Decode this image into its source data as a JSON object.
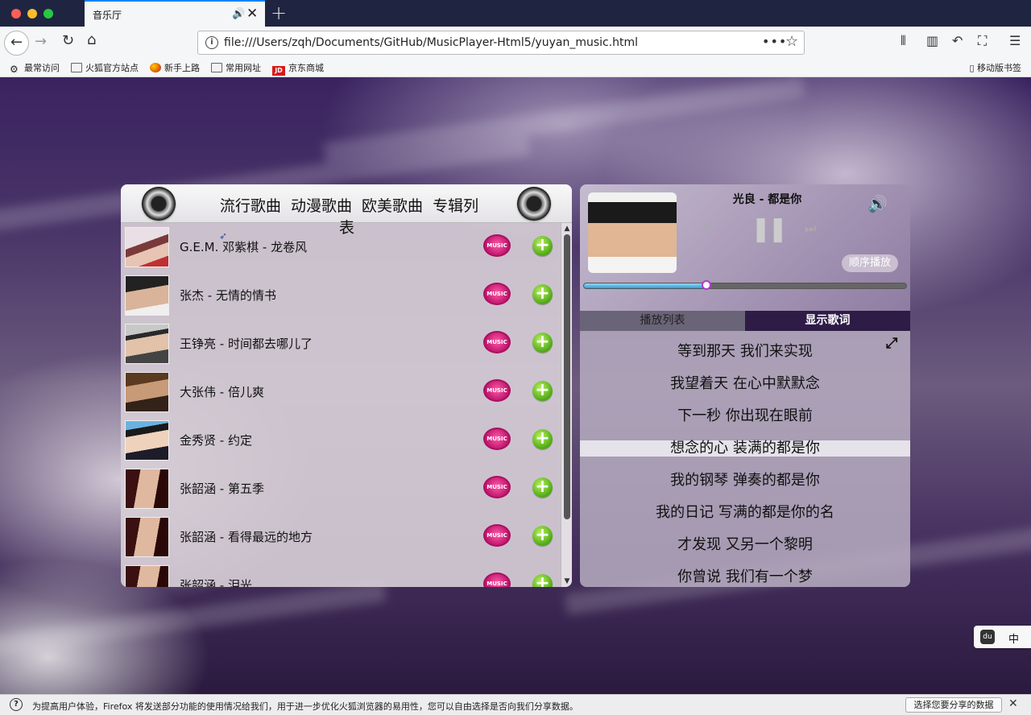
{
  "browser": {
    "tab_title": "音乐厅",
    "tab_audio_icon": "speaker-icon",
    "url": "file:///Users/zqh/Documents/GitHub/MusicPlayer-Html5/yuyan_music.html",
    "bookmarks": [
      "最常访问",
      "火狐官方站点",
      "新手上路",
      "常用网址",
      "京东商城"
    ],
    "bookmark_right": "移动版书签",
    "jd_label": "JD"
  },
  "playlist": {
    "categories": [
      "流行歌曲",
      "动漫歌曲",
      "欧美歌曲",
      "专辑列表"
    ],
    "songs": [
      {
        "title": "G.E.M. 邓紫棋 - 龙卷风",
        "music_label": "MUSIC"
      },
      {
        "title": "张杰 - 无情的情书",
        "music_label": "MUSIC"
      },
      {
        "title": "王铮亮 - 时间都去哪儿了",
        "music_label": "MUSIC"
      },
      {
        "title": "大张伟 - 倍儿爽",
        "music_label": "MUSIC"
      },
      {
        "title": "金秀贤 - 约定",
        "music_label": "MUSIC"
      },
      {
        "title": "张韶涵 - 第五季",
        "music_label": "MUSIC"
      },
      {
        "title": "张韶涵 - 看得最远的地方",
        "music_label": "MUSIC"
      },
      {
        "title": "张韶涵 - 泪光",
        "music_label": "MUSIC"
      }
    ]
  },
  "player": {
    "now_playing": "光良 - 都是你",
    "mode": "顺序播放",
    "progress": 0.38,
    "tabs": {
      "list": "播放列表",
      "lyrics": "显示歌词"
    },
    "lyrics": [
      "等到那天 我们来实现",
      "我望着天 在心中默默念",
      "下一秒 你出现在眼前",
      "想念的心 装满的都是你",
      "我的钢琴 弹奏的都是你",
      "我的日记 写满的都是你的名",
      "才发现 又另一个黎明",
      "你曾说 我们有一个梦"
    ],
    "current_lyric_index": 3
  },
  "widget": {
    "icon_label": "du",
    "text": "中"
  },
  "notice": {
    "text": "为提高用户体验，Firefox 将发送部分功能的使用情况给我们，用于进一步优化火狐浏览器的易用性，您可以自由选择是否向我们分享数据。",
    "button": "选择您要分享的数据"
  }
}
